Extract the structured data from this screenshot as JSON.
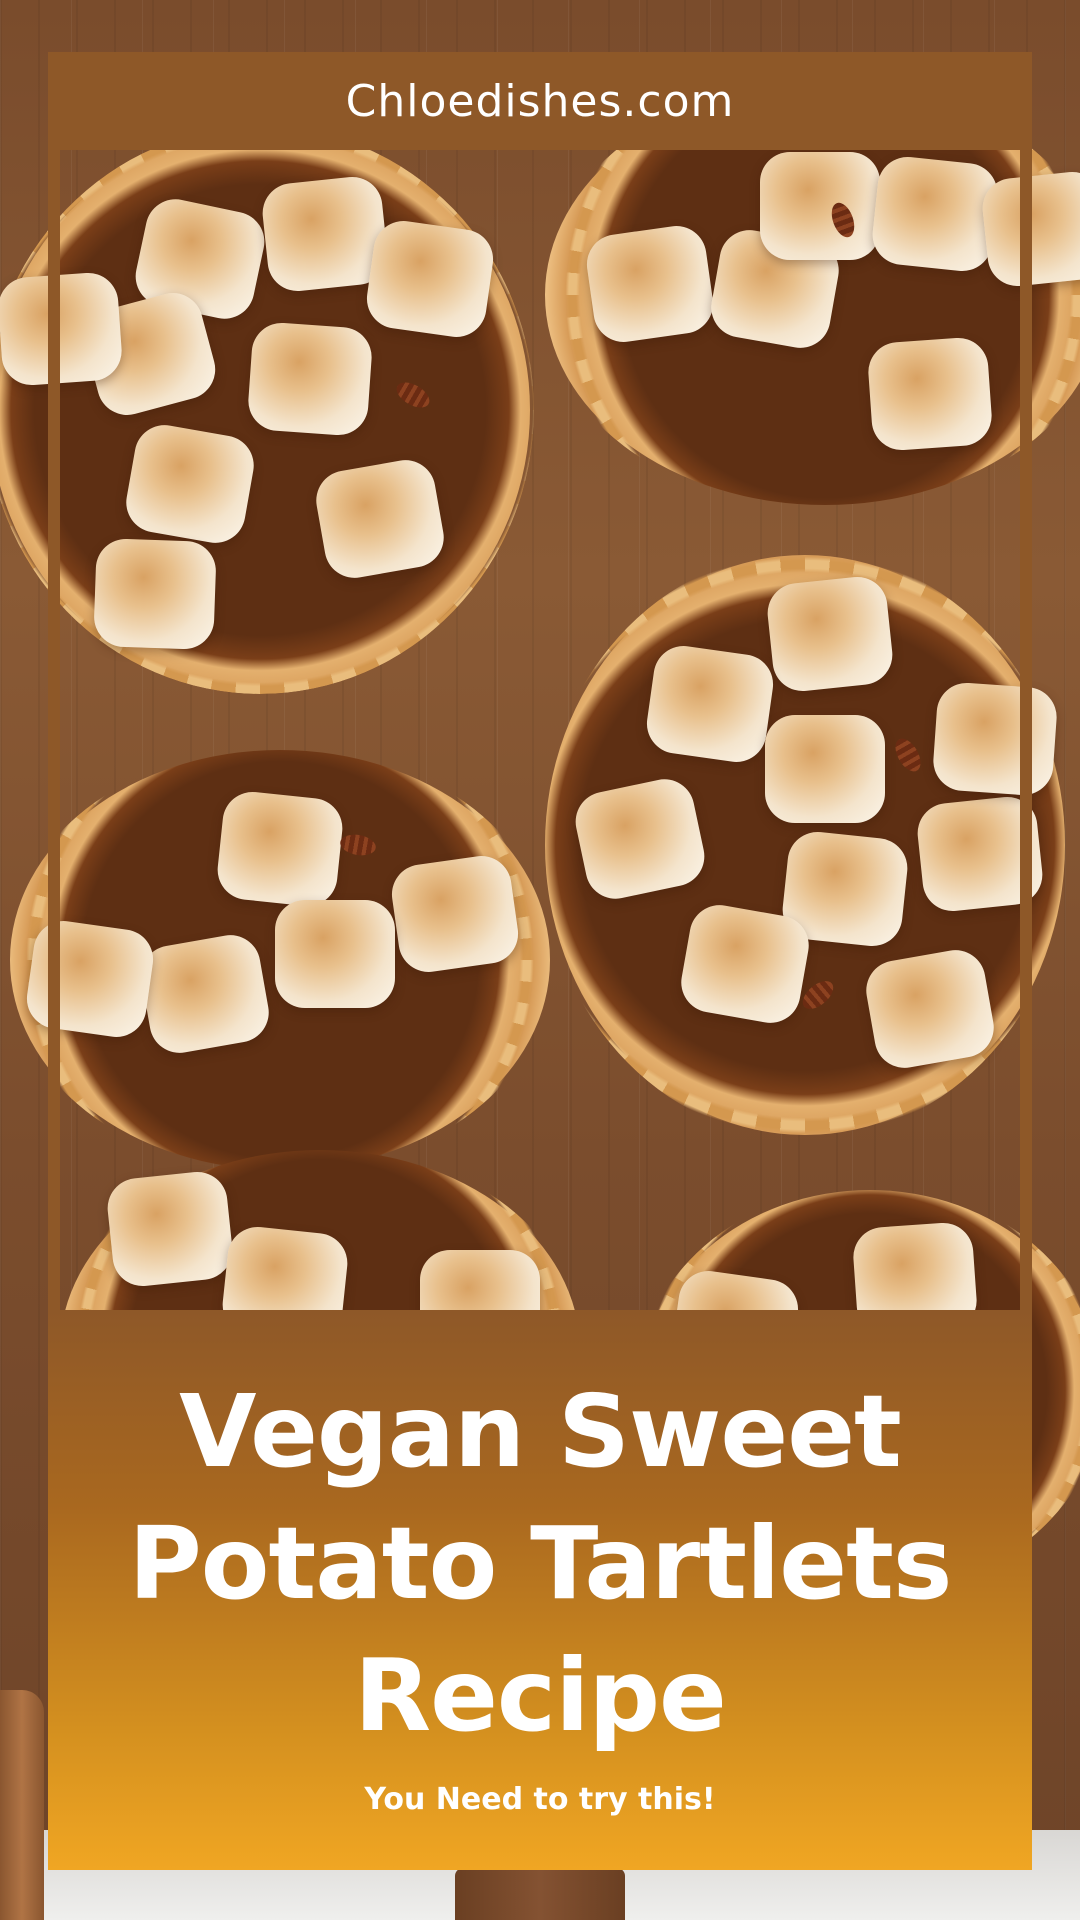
{
  "brand": {
    "site_name": "Chloedishes.com"
  },
  "headline": {
    "line1": "Vegan Sweet",
    "line2": "Potato Tartlets",
    "line3": "Recipe"
  },
  "tagline": "You Need to try this!",
  "photo": {
    "subject": "sweet-potato-tartlets-photo"
  },
  "colors": {
    "brand_bar": "#8e5828",
    "panel_top": "#8e5828",
    "panel_bottom": "#f0a623",
    "text": "#ffffff"
  }
}
